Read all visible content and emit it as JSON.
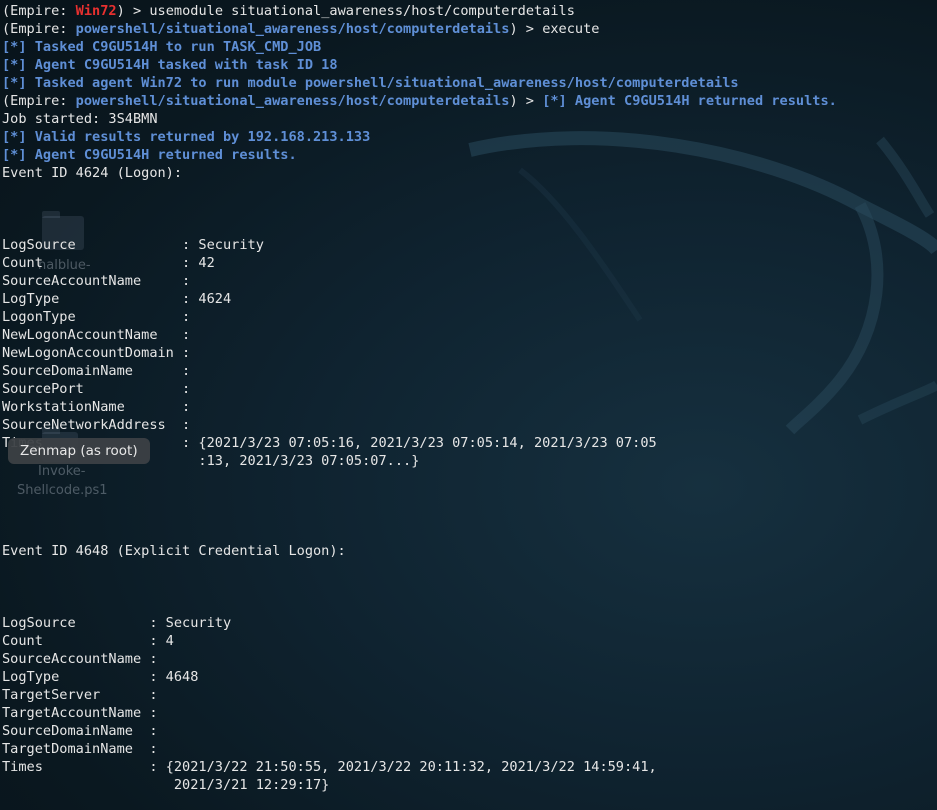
{
  "colors": {
    "info_text": "#5f8fd6",
    "agent_name": "#e8302f",
    "terminal_text": "#e6e6e6",
    "background": "#0f2330",
    "tooltip_background": "#3c4044"
  },
  "tooltip": {
    "label": "Zenmap (as root)"
  },
  "desktop": {
    "icon_labels": [
      "nalblue-",
      "Invoke-",
      "Shellcode.ps1"
    ]
  },
  "terminal": {
    "prompt_prefix": "(Empire: ",
    "prompt_suffix": ") > ",
    "agent_name": "Win72",
    "module_path": "powershell/situational_awareness/host/computerdetails",
    "cmd_usemodule": "usemodule situational_awareness/host/computerdetails",
    "cmd_execute": "execute",
    "msg_tasked_agent": "[*] Tasked C9GU514H to run TASK_CMD_JOB",
    "msg_task_id": "[*] Agent C9GU514H tasked with task ID 18",
    "msg_tasked_module": "[*] Tasked agent Win72 to run module powershell/situational_awareness/host/computerdetails",
    "msg_returned_inline": "[*] Agent C9GU514H returned results.",
    "job_started": "Job started: 3S4BMN",
    "msg_valid_results": "[*] Valid results returned by 192.168.213.133",
    "msg_returned": "[*] Agent C9GU514H returned results.",
    "event1": {
      "heading": "Event ID 4624 (Logon):",
      "rows": [
        "LogSource             : Security",
        "Count                 : 42",
        "SourceAccountName     :",
        "LogType               : 4624",
        "LogonType             :",
        "NewLogonAccountName   :",
        "NewLogonAccountDomain :",
        "SourceDomainName      :",
        "SourcePort            :",
        "WorkstationName       :",
        "SourceNetworkAddress  :",
        "Times                 : {2021/3/23 07:05:16, 2021/3/23 07:05:14, 2021/3/23 07:05",
        "                        :13, 2021/3/23 07:05:07...}"
      ]
    },
    "event2": {
      "heading": "Event ID 4648 (Explicit Credential Logon):",
      "rows": [
        "LogSource         : Security",
        "Count             : 4",
        "SourceAccountName :",
        "LogType           : 4648",
        "TargetServer      :",
        "TargetAccountName :",
        "SourceDomainName  :",
        "TargetDomainName  :",
        "Times             : {2021/3/22 21:50:55, 2021/3/22 20:11:32, 2021/3/22 14:59:41,",
        "                     2021/3/21 12:29:17}"
      ]
    }
  }
}
